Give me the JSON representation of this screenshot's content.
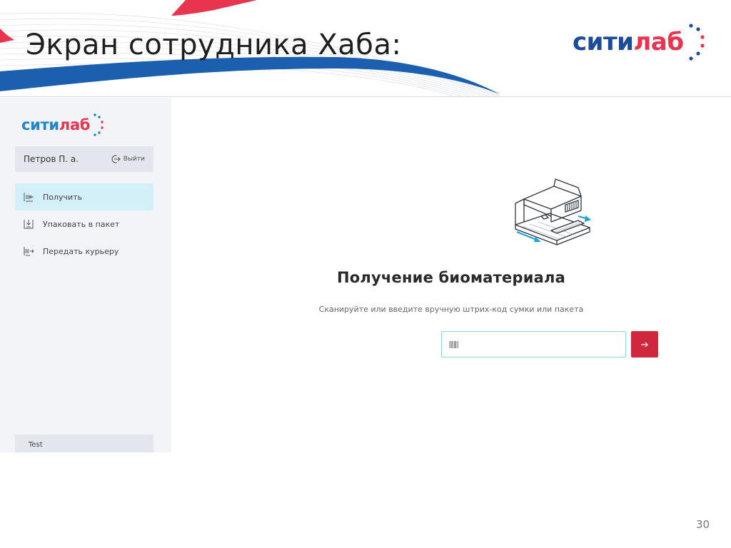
{
  "slide": {
    "title": "Экран сотрудника Хаба:",
    "page_number": "30"
  },
  "brand": {
    "logo_part1": "сити",
    "logo_part2": "лаб",
    "primary_color": "#1b4b9b",
    "accent_color": "#e8344e"
  },
  "sidebar": {
    "user": {
      "name": "Петров П. а.",
      "logout_label": "Выйти",
      "logout_icon": "logout-icon"
    },
    "items": [
      {
        "label": "Получить",
        "icon": "receive-icon",
        "active": true
      },
      {
        "label": "Упаковать в пакет",
        "icon": "pack-icon",
        "active": false
      },
      {
        "label": "Передать курьеру",
        "icon": "courier-icon",
        "active": false
      }
    ],
    "footer_label": "Test"
  },
  "main": {
    "illustration_icon": "scanner-illustration-icon",
    "title": "Получение биоматериала",
    "subtitle": "Сканируйте или введите вручную штрих-код сумки или пакета",
    "barcode_input": {
      "value": "",
      "placeholder": "",
      "icon": "barcode-icon"
    },
    "submit_icon": "arrow-right-icon",
    "submit_color": "#d0273f"
  }
}
